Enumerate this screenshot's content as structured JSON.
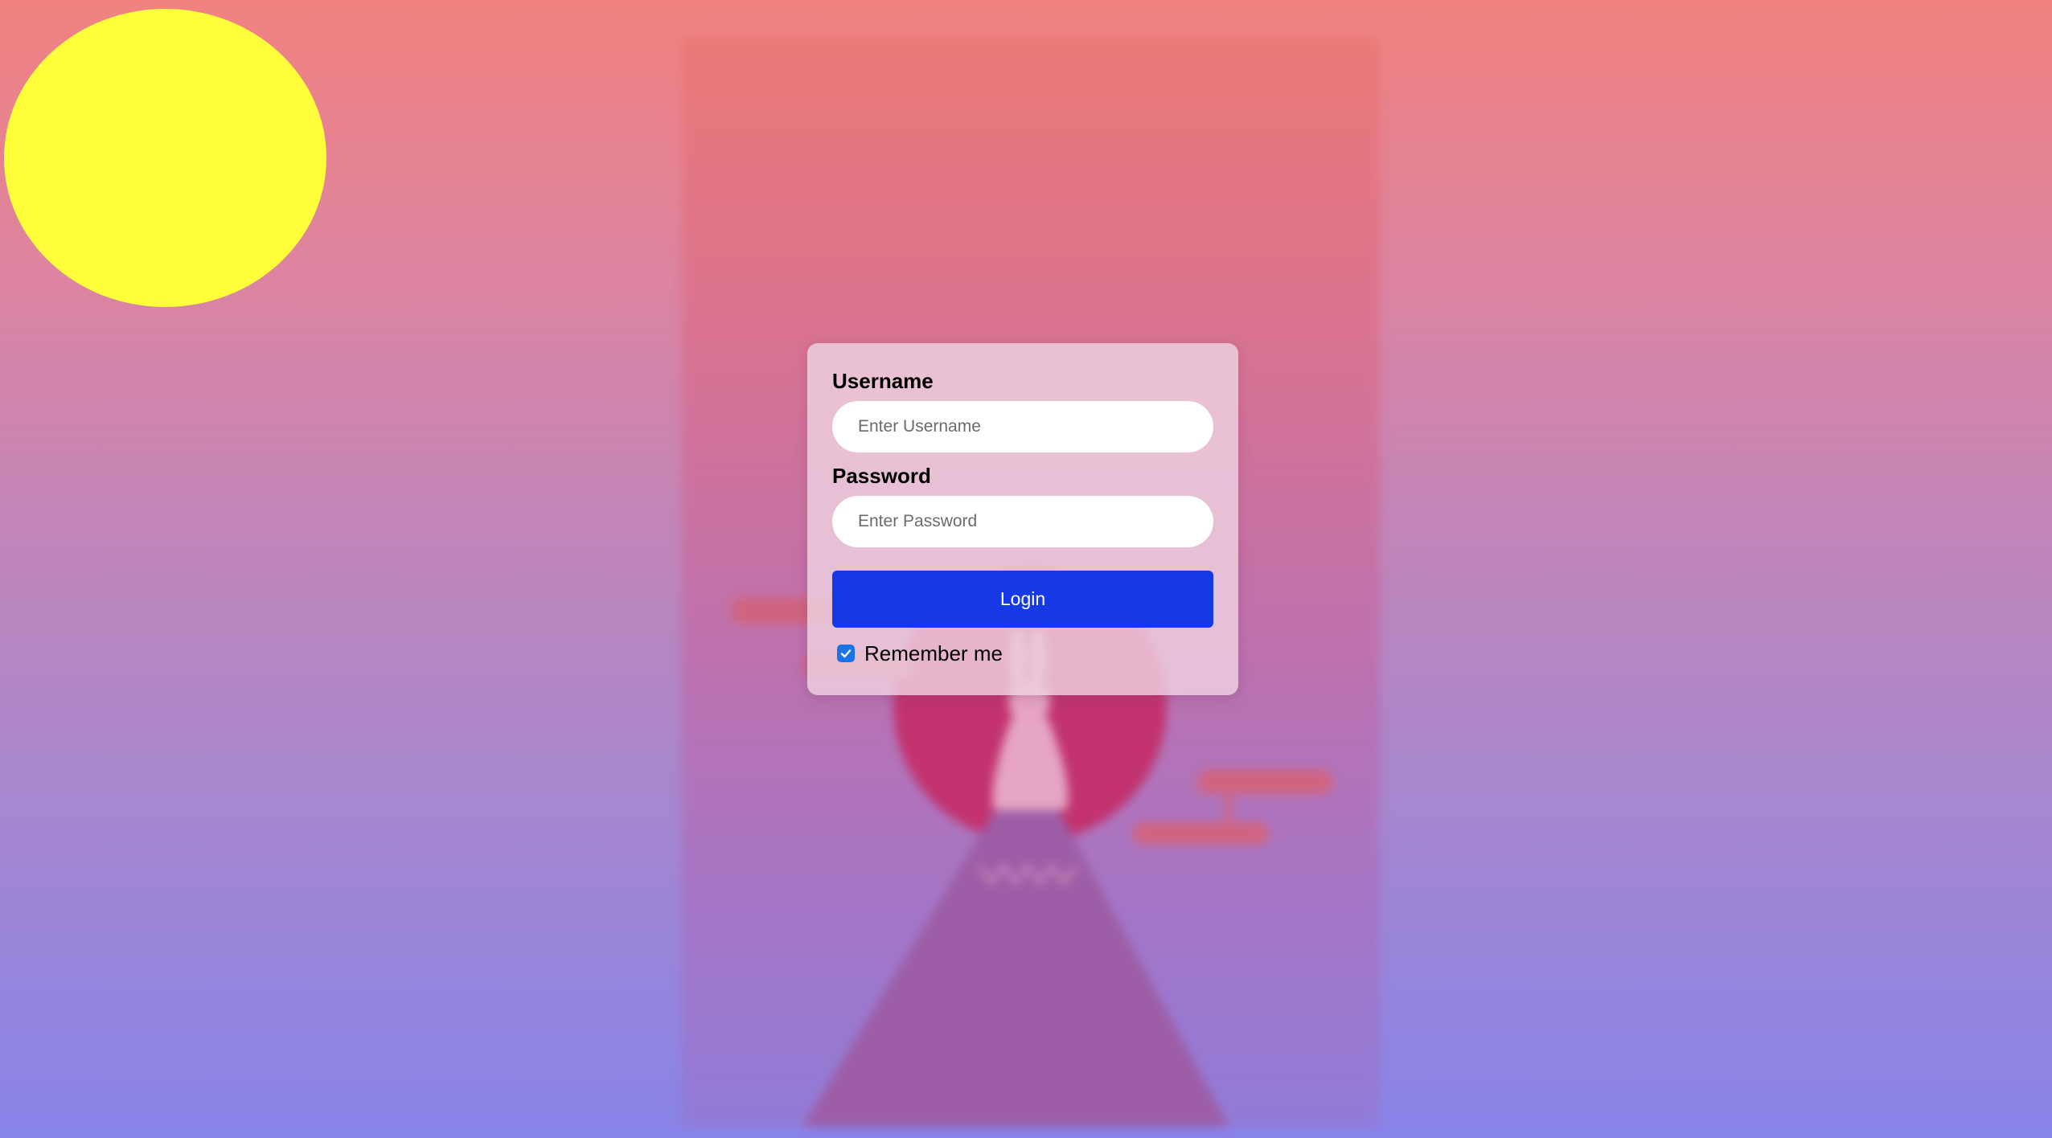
{
  "colors": {
    "sun": "#ffff3b",
    "accent_button": "#1639e6",
    "checkbox": "#1a73e8",
    "card_background": "#eed2e0"
  },
  "background": {
    "icon": "blurred-poster-rabbit-mountain-moon"
  },
  "login_form": {
    "username_label": "Username",
    "username_placeholder": "Enter Username",
    "username_value": "",
    "password_label": "Password",
    "password_placeholder": "Enter Password",
    "password_value": "",
    "login_button_label": "Login",
    "remember_me_label": "Remember me",
    "remember_me_checked": true
  }
}
